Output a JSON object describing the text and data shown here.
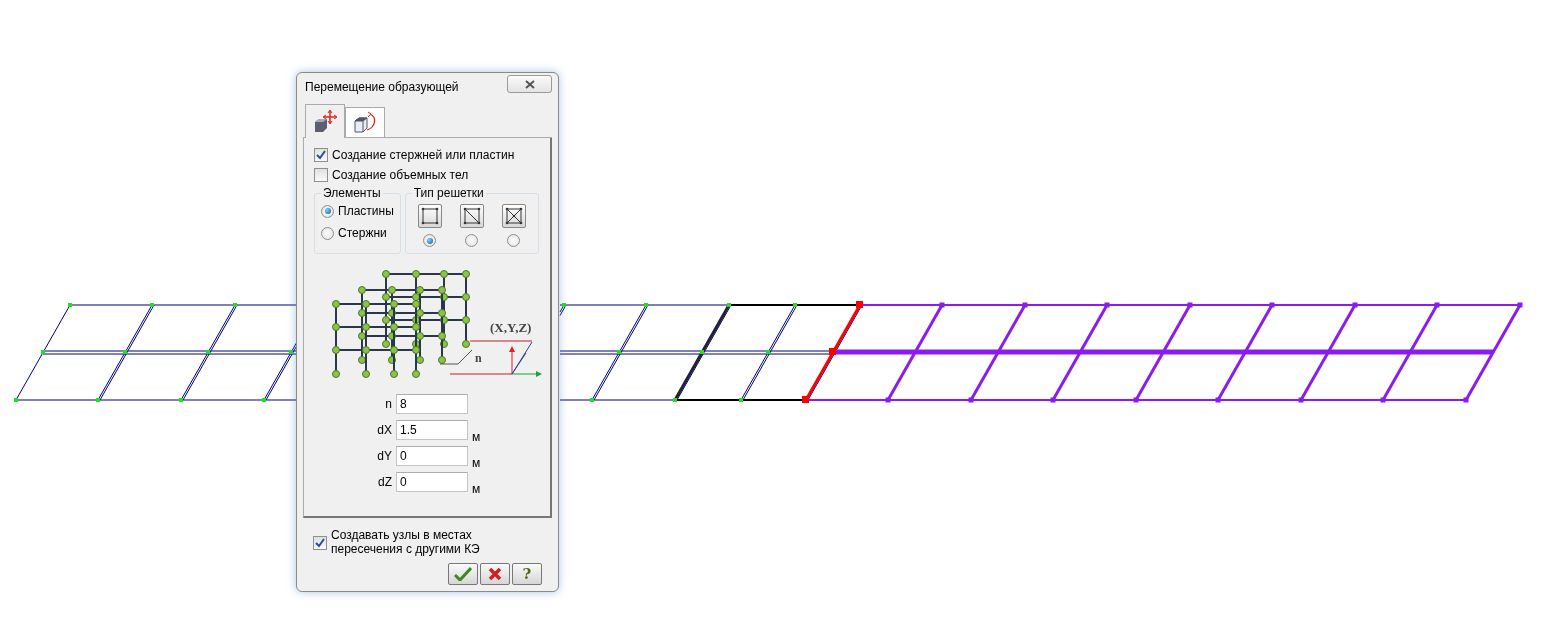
{
  "window": {
    "title": "Перемещение образующей"
  },
  "tabs": [
    {
      "kind": "move",
      "selected": true
    },
    {
      "kind": "rotate",
      "selected": false
    }
  ],
  "options": [
    {
      "label": "Создание стержней или пластин",
      "checked": true
    },
    {
      "label": "Создание объемных тел",
      "checked": false
    }
  ],
  "elements_group": {
    "title": "Элементы",
    "items": [
      {
        "label": "Пластины",
        "selected": true
      },
      {
        "label": "Стержни",
        "selected": false
      }
    ]
  },
  "lattice_group": {
    "title": "Тип решетки",
    "items": [
      {
        "kind": "square",
        "selected": true
      },
      {
        "kind": "diagonal",
        "selected": false
      },
      {
        "kind": "cross",
        "selected": false
      }
    ]
  },
  "diagram": {
    "point_label": "(X,Y,Z)",
    "count_label": "n"
  },
  "fields": [
    {
      "label": "n",
      "value": "8"
    },
    {
      "label": "dX",
      "value": "1.5",
      "unit": "м"
    },
    {
      "label": "dY",
      "value": "0",
      "unit": "м"
    },
    {
      "label": "dZ",
      "value": "0",
      "unit": "м"
    }
  ],
  "intersect_option": {
    "label": "Создавать узлы в местах пересечения с другими КЭ",
    "checked": true
  },
  "buttons": [
    {
      "kind": "ok"
    },
    {
      "kind": "cancel"
    },
    {
      "kind": "help",
      "text": "?"
    }
  ]
}
